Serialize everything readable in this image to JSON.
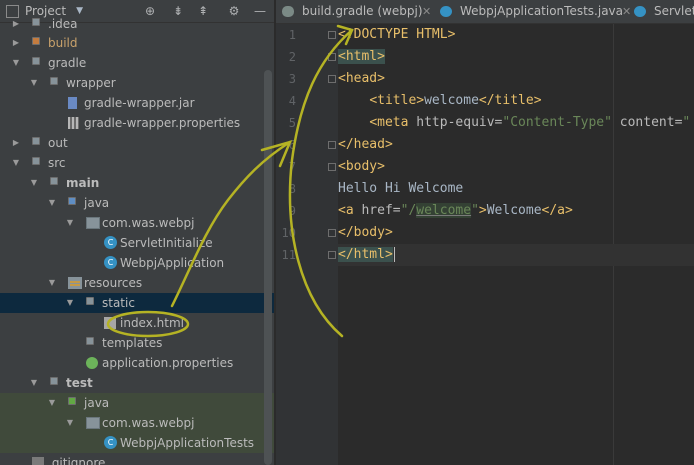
{
  "project_panel": {
    "title": "Project",
    "tools": {
      "target_icon": "crosshair-target-icon",
      "collapse_icon": "collapse-all-icon",
      "expand_icon": "expand-all-icon",
      "settings_icon": "gear-icon",
      "hide_icon": "minimize-icon"
    },
    "tree": [
      {
        "label": ".idea"
      },
      {
        "label": "build"
      },
      {
        "label": "gradle"
      },
      {
        "label": "wrapper"
      },
      {
        "label": "gradle-wrapper.jar"
      },
      {
        "label": "gradle-wrapper.properties"
      },
      {
        "label": "out"
      },
      {
        "label": "src"
      },
      {
        "label": "main"
      },
      {
        "label": "java"
      },
      {
        "label": "com.was.webpj"
      },
      {
        "label": "ServletInitialize"
      },
      {
        "label": "WebpjApplication"
      },
      {
        "label": "resources"
      },
      {
        "label": "static"
      },
      {
        "label": "index.html"
      },
      {
        "label": "templates"
      },
      {
        "label": "application.properties"
      },
      {
        "label": "test"
      },
      {
        "label": "java"
      },
      {
        "label": "com.was.webpj"
      },
      {
        "label": "WebpjApplicationTests"
      },
      {
        "label": ".gitignore"
      }
    ]
  },
  "editor": {
    "tabs": [
      {
        "label": "build.gradle (webpj)"
      },
      {
        "label": "WebpjApplicationTests.java"
      },
      {
        "label": "ServletIr"
      }
    ],
    "line_numbers": [
      "1",
      "2",
      "3",
      "4",
      "5",
      "6",
      "7",
      "8",
      "9",
      "10",
      "11"
    ],
    "code": {
      "l1": {
        "t1": "<!DOCTYPE HTML>"
      },
      "l2": {
        "t1": "<html>"
      },
      "l3": {
        "t1": "<head>"
      },
      "l4": {
        "ind": "    ",
        "t1": "<title>",
        "t2": "welcome",
        "t3": "</title>"
      },
      "l5": {
        "ind": "    ",
        "t1": "<meta ",
        "t2": "http-equiv=",
        "t3": "\"Content-Type\"",
        "t4": " content=",
        "t5": "\""
      },
      "l6": {
        "t1": "</head>"
      },
      "l7": {
        "t1": "<body>"
      },
      "l8": {
        "t1": "Hello Hi Welcome"
      },
      "l9": {
        "t1": "<a ",
        "t2": "href=",
        "t3": "\"/",
        "t4": "welcome",
        "t5": "\"",
        "t6": ">",
        "t7": "Welcome",
        "t8": "</a>"
      },
      "l10": {
        "t1": "</body>"
      },
      "l11": {
        "t1": "</html>"
      }
    }
  },
  "colors": {
    "annotation": "#b5b324",
    "selection": "#0d293e",
    "tag": "#e8bf6a",
    "string": "#6a8759"
  }
}
